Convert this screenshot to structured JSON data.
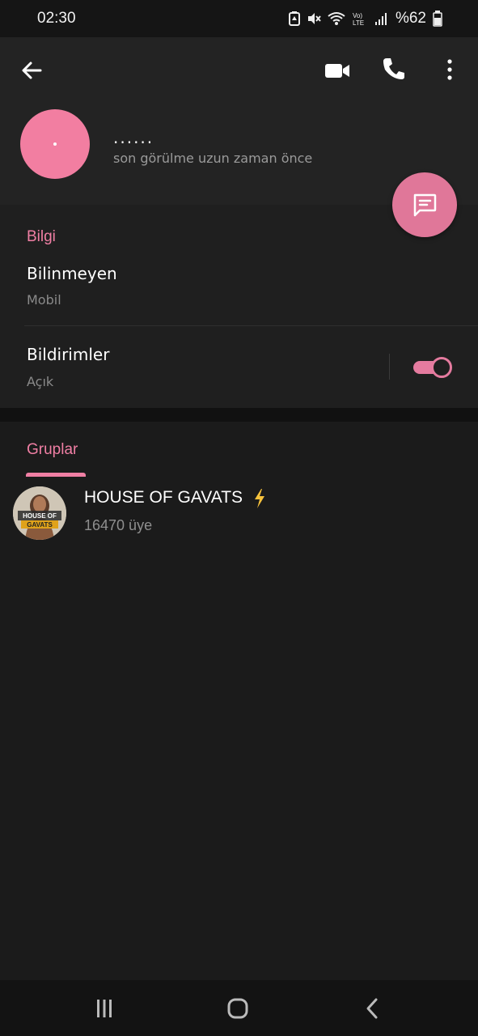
{
  "status_bar": {
    "time": "02:30",
    "battery": "%62",
    "icons": [
      "battery-saver-icon",
      "mute-icon",
      "wifi-icon",
      "volte-icon",
      "signal-icon",
      "battery-icon"
    ]
  },
  "header": {
    "back_icon": "arrow-left-icon",
    "video_icon": "video-camera-icon",
    "call_icon": "phone-icon",
    "more_icon": "more-vertical-icon",
    "name": "......",
    "status": "son görülme uzun zaman önce",
    "avatar_color": "#f27ea1"
  },
  "fab": {
    "icon": "message-icon",
    "color": "#e07799"
  },
  "info": {
    "section_title": "Bilgi",
    "phone_title": "Bilinmeyen",
    "phone_sub": "Mobil",
    "notifications_title": "Bildirimler",
    "notifications_sub": "Açık",
    "notifications_enabled": true
  },
  "groups": {
    "tab_label": "Gruplar",
    "items": [
      {
        "name": "HOUSE OF GAVATS",
        "emoji_icon": "lightning-icon",
        "members": "16470 üye",
        "avatar_text": "HOUSE OF GAVATS"
      }
    ]
  },
  "accent_color": "#f07fa4",
  "nav_bar": {
    "recents_icon": "recents-icon",
    "home_icon": "home-icon",
    "back_icon": "nav-back-icon"
  }
}
